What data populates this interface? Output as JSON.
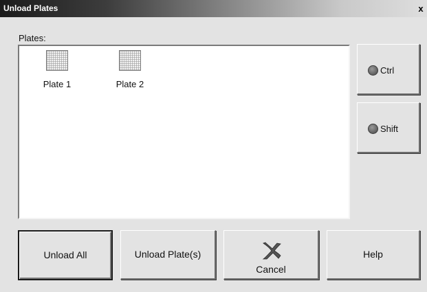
{
  "window": {
    "title": "Unload Plates",
    "close_glyph": "x"
  },
  "plates": {
    "label": "Plates:",
    "items": [
      {
        "label": "Plate 1",
        "icon": "plate-icon"
      },
      {
        "label": "Plate 2",
        "icon": "plate-icon"
      }
    ]
  },
  "modifiers": {
    "ctrl_label": "Ctrl",
    "shift_label": "Shift",
    "indicator_color": "#6c6c6c"
  },
  "buttons": {
    "unload_all": "Unload All",
    "unload_plates": "Unload Plate(s)",
    "cancel": "Cancel",
    "cancel_icon": "cancel-x-icon",
    "help": "Help"
  }
}
